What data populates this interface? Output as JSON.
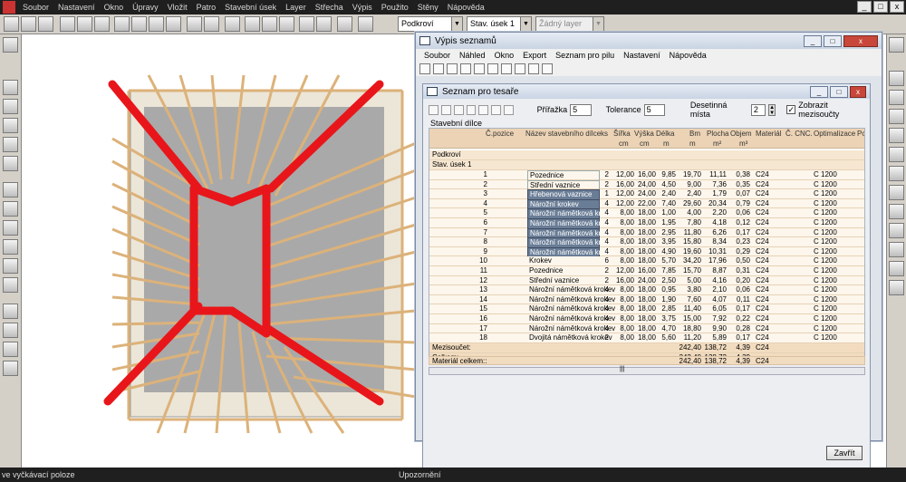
{
  "app": {
    "menu": [
      "Soubor",
      "Nastavení",
      "Okno",
      "Úpravy",
      "Vložit",
      "Patro",
      "Stavební úsek",
      "Layer",
      "Střecha",
      "Výpis",
      "Použito",
      "Stěny",
      "Nápověda"
    ],
    "window_controls": [
      "_",
      "□",
      "x"
    ]
  },
  "toolbar": {
    "floor": "Podkroví",
    "section": "Stav. úsek 1",
    "layer": "Žádný layer",
    "dropdown_arrow": "▼"
  },
  "status": {
    "left": "ve vyčkávací poloze",
    "center": "Upozornění"
  },
  "list_window": {
    "title": "Výpis seznamů",
    "menu": [
      "Soubor",
      "Náhled",
      "Okno",
      "Export",
      "Seznam pro pilu",
      "Nastavení",
      "Nápověda"
    ],
    "controls": [
      "_",
      "□",
      "x"
    ]
  },
  "carpenter": {
    "title": "Seznam pro tesaře",
    "controls": [
      "_",
      "□",
      "x"
    ],
    "labels": {
      "allowance": "Přířažka",
      "tolerance": "Tolerance",
      "decimals": "Desetinná místa",
      "subtotals": "Zobrazit mezisoučty",
      "components": "Stavební dílce"
    },
    "values": {
      "allowance": "5",
      "tolerance": "5",
      "decimals": "2",
      "subtotals_checked": "✓",
      "spin_up": "▲",
      "spin_down": "▼"
    },
    "headers": {
      "pos": "Č.pozice",
      "name": "Název stavebního dílce",
      "ks": "ks",
      "width": "Šířka",
      "height": "Výška",
      "length": "Délka",
      "bm": "Bm",
      "area": "Plocha",
      "volume": "Objem",
      "material": "Materiál",
      "cnc": "Č. CNC.",
      "opt": "Optimalizace",
      "note": "Poz"
    },
    "units": {
      "width": "cm",
      "height": "cm",
      "length": "m",
      "bm": "m",
      "area": "m²",
      "volume": "m³"
    },
    "groups": [
      "Podkroví",
      "Stav. úsek 1"
    ],
    "rows": [
      {
        "pos": "1",
        "name": "Pozednice",
        "ks": "2",
        "w": "12,00",
        "h": "16,00",
        "l": "9,85",
        "bm": "19,70",
        "a": "11,11",
        "v": "0,38",
        "m": "C24",
        "o": "C 1200",
        "st": "frm"
      },
      {
        "pos": "2",
        "name": "Střední vaznice",
        "ks": "2",
        "w": "16,00",
        "h": "24,00",
        "l": "4,50",
        "bm": "9,00",
        "a": "7,36",
        "v": "0,35",
        "m": "C24",
        "o": "C 1200",
        "st": "frm"
      },
      {
        "pos": "3",
        "name": "Hřebenová vaznice",
        "ks": "1",
        "w": "12,00",
        "h": "24,00",
        "l": "2,40",
        "bm": "2,40",
        "a": "1,79",
        "v": "0,07",
        "m": "C24",
        "o": "C 1200",
        "st": "sel"
      },
      {
        "pos": "4",
        "name": "Nárožní krokev",
        "ks": "4",
        "w": "12,00",
        "h": "22,00",
        "l": "7,40",
        "bm": "29,60",
        "a": "20,34",
        "v": "0,79",
        "m": "C24",
        "o": "C 1200",
        "st": "sel"
      },
      {
        "pos": "5",
        "name": "Nárožní námětková krokev",
        "ks": "4",
        "w": "8,00",
        "h": "18,00",
        "l": "1,00",
        "bm": "4,00",
        "a": "2,20",
        "v": "0,06",
        "m": "C24",
        "o": "C 1200",
        "st": "sel"
      },
      {
        "pos": "6",
        "name": "Nárožní námětková krokev",
        "ks": "4",
        "w": "8,00",
        "h": "18,00",
        "l": "1,95",
        "bm": "7,80",
        "a": "4,18",
        "v": "0,12",
        "m": "C24",
        "o": "C 1200",
        "st": "sel"
      },
      {
        "pos": "7",
        "name": "Nárožní námětková krokev",
        "ks": "4",
        "w": "8,00",
        "h": "18,00",
        "l": "2,95",
        "bm": "11,80",
        "a": "6,26",
        "v": "0,17",
        "m": "C24",
        "o": "C 1200",
        "st": "sel"
      },
      {
        "pos": "8",
        "name": "Nárožní námětková krokev",
        "ks": "4",
        "w": "8,00",
        "h": "18,00",
        "l": "3,95",
        "bm": "15,80",
        "a": "8,34",
        "v": "0,23",
        "m": "C24",
        "o": "C 1200",
        "st": "sel"
      },
      {
        "pos": "9",
        "name": "Nárožní námětková krokev",
        "ks": "4",
        "w": "8,00",
        "h": "18,00",
        "l": "4,90",
        "bm": "19,60",
        "a": "10,31",
        "v": "0,29",
        "m": "C24",
        "o": "C 1200",
        "st": "sel"
      },
      {
        "pos": "10",
        "name": "Krokev",
        "ks": "6",
        "w": "8,00",
        "h": "18,00",
        "l": "5,70",
        "bm": "34,20",
        "a": "17,96",
        "v": "0,50",
        "m": "C24",
        "o": "C 1200",
        "st": ""
      },
      {
        "pos": "11",
        "name": "Pozednice",
        "ks": "2",
        "w": "12,00",
        "h": "16,00",
        "l": "7,85",
        "bm": "15,70",
        "a": "8,87",
        "v": "0,31",
        "m": "C24",
        "o": "C 1200",
        "st": ""
      },
      {
        "pos": "12",
        "name": "Střední vaznice",
        "ks": "2",
        "w": "16,00",
        "h": "24,00",
        "l": "2,50",
        "bm": "5,00",
        "a": "4,16",
        "v": "0,20",
        "m": "C24",
        "o": "C 1200",
        "st": ""
      },
      {
        "pos": "13",
        "name": "Nárožní námětková krokev",
        "ks": "4",
        "w": "8,00",
        "h": "18,00",
        "l": "0,95",
        "bm": "3,80",
        "a": "2,10",
        "v": "0,06",
        "m": "C24",
        "o": "C 1200",
        "st": ""
      },
      {
        "pos": "14",
        "name": "Nárožní námětková krokev",
        "ks": "4",
        "w": "8,00",
        "h": "18,00",
        "l": "1,90",
        "bm": "7,60",
        "a": "4,07",
        "v": "0,11",
        "m": "C24",
        "o": "C 1200",
        "st": ""
      },
      {
        "pos": "15",
        "name": "Nárožní námětková krokev",
        "ks": "4",
        "w": "8,00",
        "h": "18,00",
        "l": "2,85",
        "bm": "11,40",
        "a": "6,05",
        "v": "0,17",
        "m": "C24",
        "o": "C 1200",
        "st": ""
      },
      {
        "pos": "16",
        "name": "Nárožní námětková krokev",
        "ks": "4",
        "w": "8,00",
        "h": "18,00",
        "l": "3,75",
        "bm": "15,00",
        "a": "7,92",
        "v": "0,22",
        "m": "C24",
        "o": "C 1200",
        "st": ""
      },
      {
        "pos": "17",
        "name": "Nárožní námětková krokev",
        "ks": "4",
        "w": "8,00",
        "h": "18,00",
        "l": "4,70",
        "bm": "18,80",
        "a": "9,90",
        "v": "0,28",
        "m": "C24",
        "o": "C 1200",
        "st": ""
      },
      {
        "pos": "18",
        "name": "Dvojitá námětková krokev",
        "ks": "2",
        "w": "8,00",
        "h": "18,00",
        "l": "5,60",
        "bm": "11,20",
        "a": "5,89",
        "v": "0,17",
        "m": "C24",
        "o": "C 1200",
        "st": ""
      }
    ],
    "subtotal": {
      "label": "Mezisoučet:",
      "bm": "242,40",
      "a": "138,72",
      "v": "4,39",
      "m": "C24"
    },
    "total": {
      "label": "Celkem:",
      "bm": "242,40",
      "a": "138,72",
      "v": "4,39"
    },
    "material_total": {
      "label": "Materiál celkem::",
      "bm": "242,40",
      "a": "138,72",
      "v": "4,39",
      "m": "C24"
    },
    "scroll_handle": "|||",
    "close_button": "Zavřít"
  },
  "colors": {
    "rafter_red": "#e8161a",
    "timber": "#dcb27a",
    "roof_gray": "#a9a9a9",
    "header_tan": "#ecd3b5",
    "selected": "#6a7d96"
  }
}
